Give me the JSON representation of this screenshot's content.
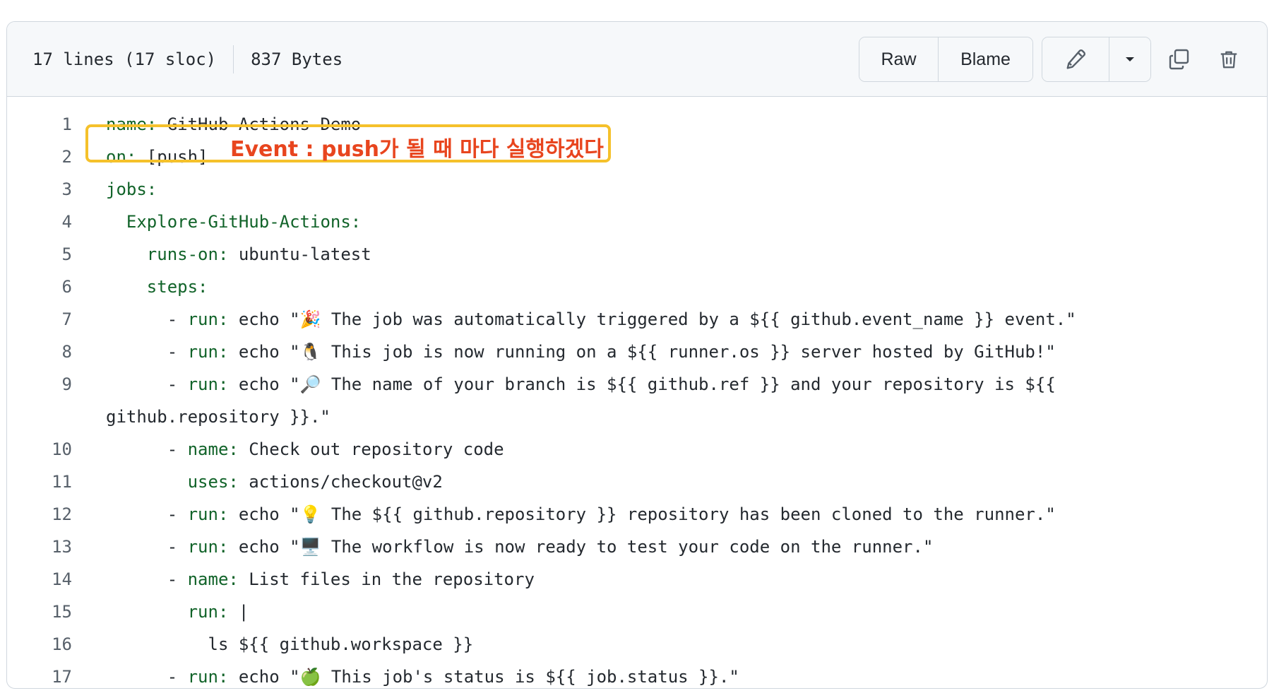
{
  "header": {
    "lines": "17 lines (17 sloc)",
    "size": "837 Bytes",
    "raw_label": "Raw",
    "blame_label": "Blame",
    "icons": [
      "pencil-icon",
      "caret-down-icon",
      "copy-icon",
      "trash-icon"
    ]
  },
  "annotation": {
    "text": "Event : push가 될 때 마다 실행하겠다",
    "color": "#e8451e",
    "border_color": "#f5c12b"
  },
  "code": [
    {
      "n": "1",
      "key": "name",
      "rest": " GitHub Actions Demo",
      "indent": ""
    },
    {
      "n": "2",
      "key": "on",
      "rest": " [push]",
      "indent": ""
    },
    {
      "n": "3",
      "key": "jobs",
      "rest": "",
      "indent": ""
    },
    {
      "n": "4",
      "key": "Explore-GitHub-Actions",
      "rest": "",
      "indent": "  "
    },
    {
      "n": "5",
      "key": "runs-on",
      "rest": " ubuntu-latest",
      "indent": "    "
    },
    {
      "n": "6",
      "key": "steps",
      "rest": "",
      "indent": "    "
    },
    {
      "n": "7",
      "key": "run",
      "rest": " echo \"🎉 The job was automatically triggered by a ${{ github.event_name }} event.\"",
      "indent": "      - "
    },
    {
      "n": "8",
      "key": "run",
      "rest": " echo \"🐧 This job is now running on a ${{ runner.os }} server hosted by GitHub!\"",
      "indent": "      - "
    },
    {
      "n": "9",
      "key": "run",
      "rest": " echo \"🔎 The name of your branch is ${{ github.ref }} and your repository is ${{ github.repository }}.\"",
      "indent": "      - "
    },
    {
      "n": "10",
      "key": "name",
      "rest": " Check out repository code",
      "indent": "      - "
    },
    {
      "n": "11",
      "key": "uses",
      "rest": " actions/checkout@v2",
      "indent": "        "
    },
    {
      "n": "12",
      "key": "run",
      "rest": " echo \"💡 The ${{ github.repository }} repository has been cloned to the runner.\"",
      "indent": "      - "
    },
    {
      "n": "13",
      "key": "run",
      "rest": " echo \"🖥️ The workflow is now ready to test your code on the runner.\"",
      "indent": "      - "
    },
    {
      "n": "14",
      "key": "name",
      "rest": " List files in the repository",
      "indent": "      - "
    },
    {
      "n": "15",
      "key": "run",
      "rest": " |",
      "indent": "        "
    },
    {
      "n": "16",
      "key": "",
      "rest": "ls ${{ github.workspace }}",
      "indent": "          "
    },
    {
      "n": "17",
      "key": "run",
      "rest": " echo \"🍏 This job's status is ${{ job.status }}.\"",
      "indent": "      - "
    }
  ]
}
